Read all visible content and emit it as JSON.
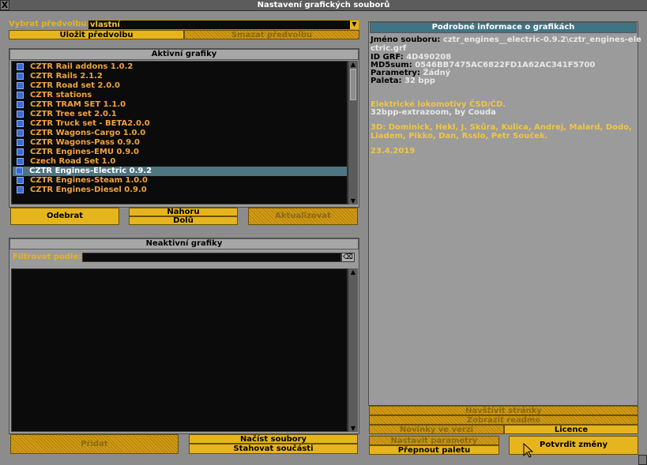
{
  "window": {
    "title": "Nastavení grafických souborů"
  },
  "preset": {
    "label": "Vybrat předvolbu:",
    "value": "vlastní",
    "save": "Uložit předvolbu",
    "delete": "Smazat předvolbu"
  },
  "active": {
    "header": "Aktivní grafiky",
    "items": [
      "CZTR Rail addons 1.0.2",
      "CZTR Rails 2.1.2",
      "CZTR Road set 2.0.0",
      "CZTR stations",
      "CZTR TRAM SET 1.1.0",
      "CZTR Tree set 2.0.1",
      "CZTR Truck set - BETA2.0.0",
      "CZTR Wagons-Cargo 1.0.0",
      "CZTR Wagons-Pass 0.9.0",
      "CZTR Engines-EMU 0.9.0",
      "Czech Road Set 1.0",
      "CZTR Engines-Electric 0.9.2",
      "CZTR Engines-Steam 1.0.0",
      "CZTR Engines-Diesel 0.9.0"
    ],
    "selected_index": 11,
    "remove": "Odebrat",
    "up": "Nahoru",
    "down": "Dolů",
    "rescan": "Aktualizovat"
  },
  "inactive": {
    "header": "Neaktivní grafiky",
    "filter_label": "Filtrovat podle:",
    "filter_value": "",
    "add": "Přidat",
    "load": "Načíst soubory",
    "download": "Stahovat součásti"
  },
  "details": {
    "header": "Podrobné informace o grafikách",
    "filename_label": "Jméno souboru:",
    "filename": "cztr_engines__electric-0.9.2\\cztr_engines-ele",
    "filename_cont": "ctric.grf",
    "grfid_label": "ID GRF:",
    "grfid": "4D490208",
    "md5_label": "MD5sum:",
    "md5": "0546BB7475AC6822FD1A62AC341F5700",
    "params_label": "Parametry:",
    "params": "Žádný",
    "palette_label": "Paleta:",
    "palette": "32 bpp",
    "desc_title": "Elektrické lokomotivy ČSD/ČD.",
    "desc_sub": "32bpp-extrazoom, by Couda",
    "authors_1": "3D: Dominick, Hekl, J. Skůra, Kulica, Andrej, Malard, Dodo,",
    "authors_2": "Liadem, Pikko, Dan, Rsslo, Petr Souček.",
    "date": "23.4.2019"
  },
  "actions": {
    "website": "Navštívit stránky",
    "readme": "Zobrazit readme",
    "changelog": "Novinky ve verzi",
    "license": "Licence",
    "set_params": "Nastavit parametry",
    "toggle_palette": "Přepnout paletu",
    "apply": "Potvrdit změny"
  },
  "colors": {
    "button": "#e6b51e",
    "list_text": "#f0a23c",
    "selection": "#4f7582",
    "window": "#8c8c8c"
  }
}
